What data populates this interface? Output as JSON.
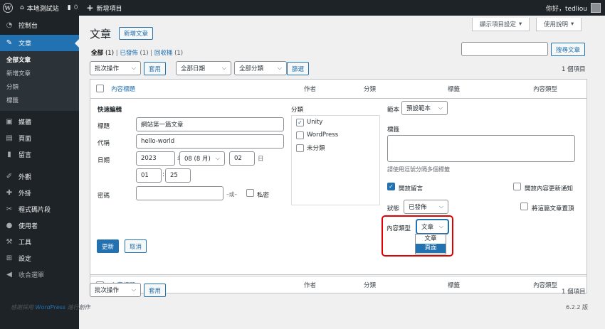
{
  "adminbar": {
    "site_name": "本地測試站",
    "comments_count": "0",
    "new_item": "新增項目",
    "greeting": "你好，tedliou"
  },
  "sidebar": {
    "items": [
      {
        "label": "控制台",
        "icon": "dashboard-icon"
      },
      {
        "label": "文章",
        "icon": "pin-icon"
      },
      {
        "label": "媒體",
        "icon": "media-icon"
      },
      {
        "label": "頁面",
        "icon": "page-icon"
      },
      {
        "label": "留言",
        "icon": "comment-icon"
      },
      {
        "label": "外觀",
        "icon": "brush-icon"
      },
      {
        "label": "外掛",
        "icon": "plugin-icon"
      },
      {
        "label": "程式碼片段",
        "icon": "scissors-icon"
      },
      {
        "label": "使用者",
        "icon": "user-icon"
      },
      {
        "label": "工具",
        "icon": "wrench-icon"
      },
      {
        "label": "設定",
        "icon": "settings-icon"
      },
      {
        "label": "收合選單",
        "icon": "collapse-icon"
      }
    ],
    "submenu": [
      "全部文章",
      "新增文章",
      "分類",
      "標籤"
    ]
  },
  "header": {
    "screen_options": "顯示項目設定",
    "help": "使用說明",
    "title": "文章",
    "add_new": "新增文章"
  },
  "filters": {
    "all": "全部",
    "all_count": "(1)",
    "published": "已發佈",
    "published_count": "(1)",
    "trash": "回收桶",
    "trash_count": "(1)",
    "search_button": "搜尋文章",
    "bulk_action": "批次操作",
    "apply": "套用",
    "all_dates": "全部日期",
    "all_categories": "全部分類",
    "filter": "篩選",
    "items_count": "1 個項目"
  },
  "table": {
    "columns": [
      "內容標題",
      "作者",
      "分類",
      "標籤",
      "內容類型"
    ]
  },
  "quick_edit": {
    "heading": "快速編輯",
    "title_label": "標題",
    "title_value": "網站第一篇文章",
    "slug_label": "代稱",
    "slug_value": "hello-world",
    "date_label": "日期",
    "year": "2023",
    "year_unit": "年",
    "month": "08 (8 月)",
    "day": "02",
    "day_unit": "日",
    "hour": "01",
    "minute": "25",
    "time_sep": ":",
    "password_label": "密碼",
    "or_text": "–或–",
    "private_label": "私密",
    "categories_label": "分類",
    "categories": [
      {
        "label": "Unity",
        "checked": true
      },
      {
        "label": "WordPress",
        "checked": false
      },
      {
        "label": "未分類",
        "checked": false
      }
    ],
    "template_label": "範本",
    "template_value": "預設範本",
    "tags_label": "標籤",
    "tags_hint": "請使用逗號分隔多個標籤",
    "allow_comments": "開放留言",
    "allow_pings": "開放內容更新通知",
    "status_label": "狀態",
    "status_value": "已發佈",
    "sticky_label": "將這篇文章置頂",
    "post_type_label": "內容類型",
    "post_type_value": "文章",
    "post_type_options": [
      "文章",
      "頁面"
    ],
    "update": "更新",
    "cancel": "取消"
  },
  "footer": {
    "thanks_pre": "感謝採用",
    "thanks_link": "WordPress",
    "thanks_post": "進行創作",
    "version": "6.2.2 版"
  },
  "colors": {
    "accent": "#2271b1",
    "admin_dark": "#1d2327",
    "highlight_red": "#e00000"
  }
}
